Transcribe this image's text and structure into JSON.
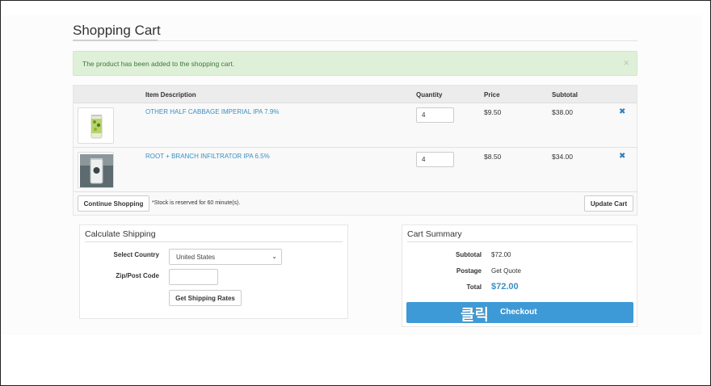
{
  "page_title": "Shopping Cart",
  "alert": {
    "message": "The product has been added to the shopping cart.",
    "close": "×"
  },
  "table": {
    "headers": [
      "Item Description",
      "Quantity",
      "Price",
      "Subtotal"
    ],
    "rows": [
      {
        "name": "OTHER HALF CABBAGE IMPERIAL IPA 7.9%",
        "quantity": "4",
        "price": "$9.50",
        "subtotal": "$38.00",
        "remove": "✖"
      },
      {
        "name": "ROOT + BRANCH INFILTRATOR IPA 6.5%",
        "quantity": "4",
        "price": "$8.50",
        "subtotal": "$34.00",
        "remove": "✖"
      }
    ],
    "continue_label": "Continue Shopping",
    "stock_note": "*Stock is reserved for 60 minute(s).",
    "update_label": "Update Cart"
  },
  "shipping": {
    "title": "Calculate Shipping",
    "country_label": "Select Country",
    "country_value": "United States",
    "zip_label": "Zip/Post Code",
    "rates_label": "Get Shipping Rates"
  },
  "summary": {
    "title": "Cart Summary",
    "subtotal_label": "Subtotal",
    "subtotal_value": "$72.00",
    "postage_label": "Postage",
    "postage_value": "Get Quote",
    "total_label": "Total",
    "total_value": "$72.00",
    "checkout_overlay": "클릭",
    "checkout_label": "Checkout"
  },
  "colors": {
    "accent": "#3a8fc2",
    "checkout": "#3d9ad6",
    "alert_bg": "#dff0d8",
    "alert_text": "#3c763d"
  }
}
